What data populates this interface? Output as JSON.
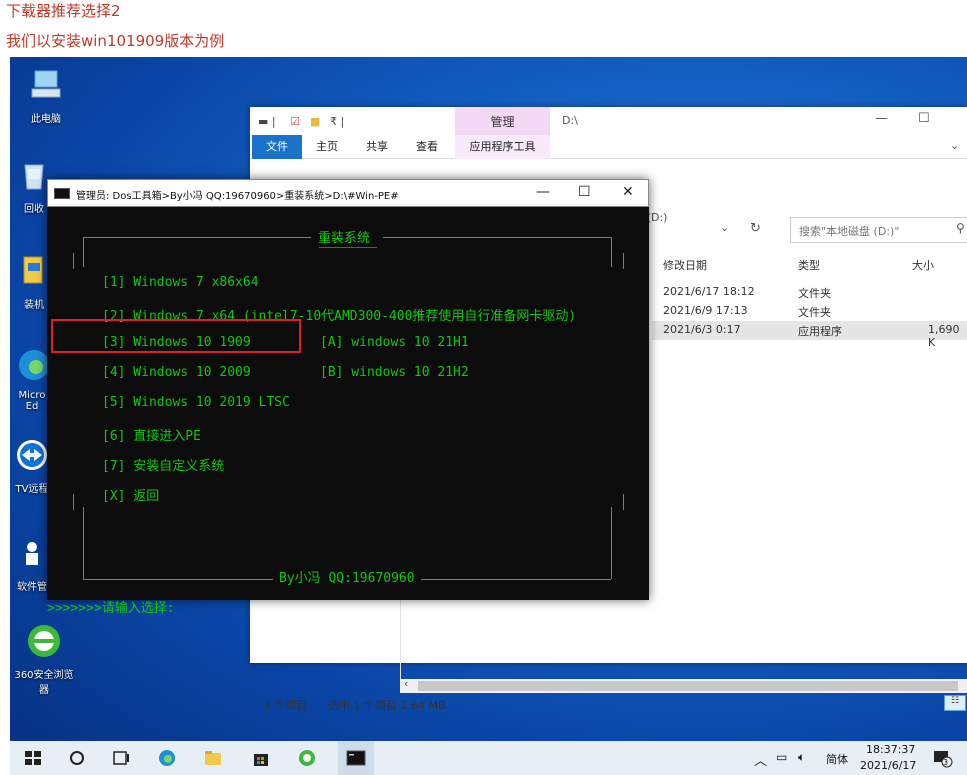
{
  "captions": {
    "line1": "下载器推荐选择2",
    "line2": "我们以安装win101909版本为例"
  },
  "desktop_icons": [
    {
      "label": "此电脑",
      "icon": "computer-icon"
    },
    {
      "label": "回收",
      "icon": "recycle-bin-icon"
    },
    {
      "label": "装机",
      "icon": "installer-icon"
    },
    {
      "label": "Micro",
      "label2": "Ed",
      "icon": "edge-icon"
    },
    {
      "label": "TV远程",
      "icon": "teamviewer-icon"
    },
    {
      "label": "软件管",
      "icon": "software-manager-icon"
    },
    {
      "label": "360安全浏览器",
      "icon": "360-browser-icon"
    }
  ],
  "explorer": {
    "manage_tab": "管理",
    "title_path": "D:\\",
    "ribbon_tabs": [
      "文件",
      "主页",
      "共享",
      "查看",
      "应用程序工具"
    ],
    "address_fragment": "此电脑 > 本地磁盘 (D:)",
    "search_placeholder": "搜索\"本地磁盘 (D:)\"",
    "columns": [
      "修改日期",
      "类型",
      "大小"
    ],
    "rows": [
      {
        "date": "2021/6/17 18:12",
        "type": "文件夹",
        "size": ""
      },
      {
        "date": "2021/6/9 17:13",
        "type": "文件夹",
        "size": ""
      },
      {
        "date": "2021/6/3 0:17",
        "type": "应用程序",
        "size": "1,690 K"
      }
    ],
    "status": {
      "count": "3 个项目",
      "selected": "选中 1 个项目  1.64 MB"
    }
  },
  "console": {
    "title": "管理员:  Dos工具箱>By小冯 QQ:19670960>重装系统>D:\\#Win-PE#",
    "heading": "重装系统",
    "menu": [
      {
        "left": "[1]  Windows 7 x86x64",
        "right": ""
      },
      {
        "left": "[2]  Windows 7 x64 (intel7-10代AMD300-400推荐使用自行准备网卡驱动)",
        "right": ""
      },
      {
        "left": "[3]  Windows 10 1909",
        "right": "[A]  windows 10 21H1"
      },
      {
        "left": "[4]  Windows 10 2009",
        "right": "[B] windows 10 21H2"
      },
      {
        "left": "[5]  Windows 10 2019 LTSC",
        "right": ""
      },
      {
        "left": "[6]  直接进入PE",
        "right": ""
      },
      {
        "left": "[7]  安装自定义系统",
        "right": ""
      },
      {
        "left": "[X]  返回",
        "right": ""
      }
    ],
    "footer": "By小冯 QQ:19670960",
    "prompt": ">>>>>>>请输入选择:"
  },
  "taskbar": {
    "ime": "简体",
    "time": "18:37:37",
    "date": "2021/6/17",
    "notifications": "3"
  }
}
